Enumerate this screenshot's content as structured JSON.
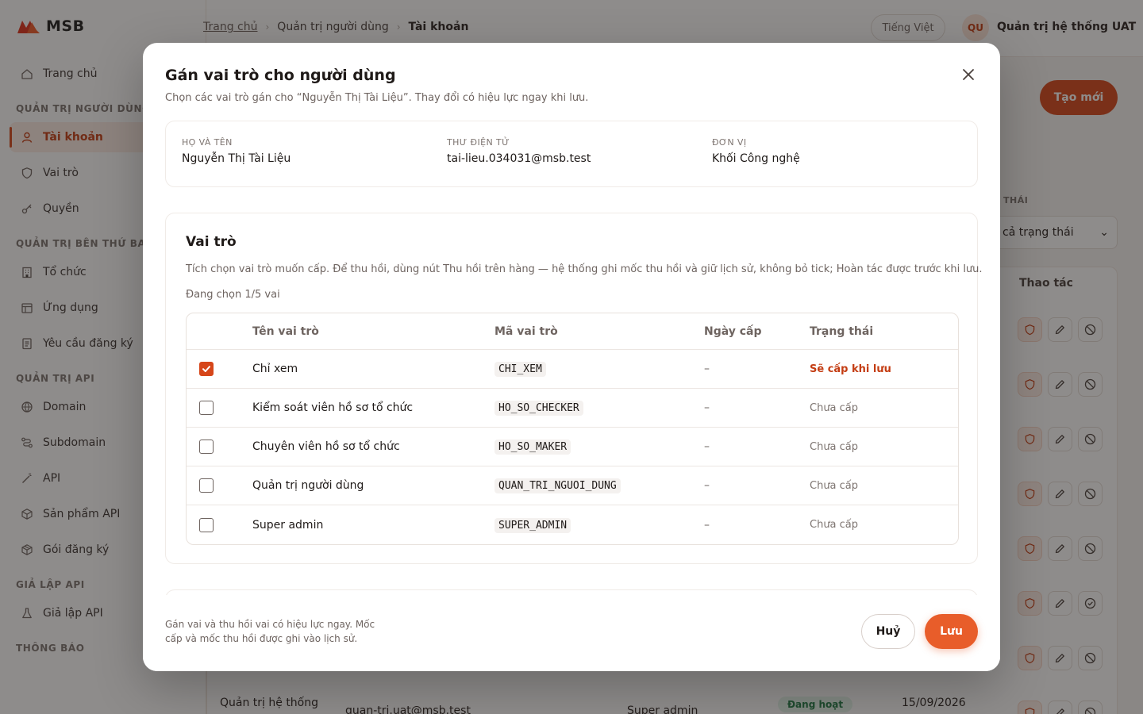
{
  "brand": {
    "name": "MSB",
    "accent": "#d6461a"
  },
  "sidebar": {
    "items": [
      {
        "label": "Trang chủ",
        "icon": "home-icon"
      },
      {
        "section": "QUẢN TRỊ NGƯỜI DÙNG"
      },
      {
        "label": "Tài khoản",
        "icon": "user-icon",
        "active": true
      },
      {
        "label": "Vai trò",
        "icon": "shield-icon"
      },
      {
        "label": "Quyền",
        "icon": "key-icon"
      },
      {
        "section": "QUẢN TRỊ BÊN THỨ BA"
      },
      {
        "label": "Tổ chức",
        "icon": "building-icon"
      },
      {
        "label": "Ứng dụng",
        "icon": "app-window-icon"
      },
      {
        "label": "Yêu cầu đăng ký",
        "icon": "document-icon"
      },
      {
        "section": "QUẢN TRỊ API"
      },
      {
        "label": "Domain",
        "icon": "globe-icon"
      },
      {
        "label": "Subdomain",
        "icon": "route-icon"
      },
      {
        "label": "API",
        "icon": "wand-icon"
      },
      {
        "label": "Sản phẩm API",
        "icon": "box-icon"
      },
      {
        "label": "Gói đăng ký",
        "icon": "package-icon"
      },
      {
        "section": "GIẢ LẬP API"
      },
      {
        "label": "Giả lập API",
        "icon": "flask-icon"
      },
      {
        "section": "THÔNG BÁO"
      }
    ]
  },
  "topbar": {
    "breadcrumb": {
      "home": "Trang chủ",
      "parent": "Quản trị người dùng",
      "current": "Tài khoản"
    },
    "language": "Tiếng Việt",
    "user": {
      "initials": "QU",
      "name": "Quản trị hệ thống UAT"
    }
  },
  "page": {
    "create_label": "Tạo mới",
    "status_filter_label": "THÁI",
    "status_filter_value": "cả trạng thái",
    "actions_header": "Thao tác",
    "last_row": {
      "name": "Quản trị hệ thống",
      "email": "quan-tri.uat@msb.test",
      "role": "Super admin",
      "status": "Đang hoạt",
      "date": "15/09/2026"
    }
  },
  "modal": {
    "title": "Gán vai trò cho người dùng",
    "subtitle": "Chọn các vai trò gán cho “Nguyễn Thị Tài Liệu”. Thay đổi có hiệu lực ngay khi lưu.",
    "info": {
      "name_label": "HỌ VÀ TÊN",
      "name": "Nguyễn Thị Tài Liệu",
      "email_label": "THƯ ĐIỆN TỬ",
      "email": "tai-lieu.034031@msb.test",
      "unit_label": "ĐƠN VỊ",
      "unit": "Khối Công nghệ"
    },
    "roles": {
      "title": "Vai trò",
      "description": "Tích chọn vai trò muốn cấp. Để thu hồi, dùng nút Thu hồi trên hàng — hệ thống ghi mốc thu hồi và giữ lịch sử, không bỏ tick; Hoàn tác được trước khi lưu.",
      "count_text": "Đang chọn 1/5 vai",
      "headers": {
        "name": "Tên vai trò",
        "code": "Mã vai trò",
        "date": "Ngày cấp",
        "status": "Trạng thái"
      },
      "rows": [
        {
          "name": "Chỉ xem",
          "code": "CHI_XEM",
          "date": "–",
          "status": "Sẽ cấp khi lưu",
          "checked": true
        },
        {
          "name": "Kiểm soát viên hồ sơ tổ chức",
          "code": "HO_SO_CHECKER",
          "date": "–",
          "status": "Chưa cấp",
          "checked": false
        },
        {
          "name": "Chuyên viên hồ sơ tổ chức",
          "code": "HO_SO_MAKER",
          "date": "–",
          "status": "Chưa cấp",
          "checked": false
        },
        {
          "name": "Quản trị người dùng",
          "code": "QUAN_TRI_NGUOI_DUNG",
          "date": "–",
          "status": "Chưa cấp",
          "checked": false
        },
        {
          "name": "Super admin",
          "code": "SUPER_ADMIN",
          "date": "–",
          "status": "Chưa cấp",
          "checked": false
        }
      ]
    },
    "footer": {
      "note": "Gán vai và thu hồi vai có hiệu lực ngay. Mốc cấp và mốc thu hồi được ghi vào lịch sử.",
      "cancel": "Huỷ",
      "save": "Lưu"
    }
  }
}
